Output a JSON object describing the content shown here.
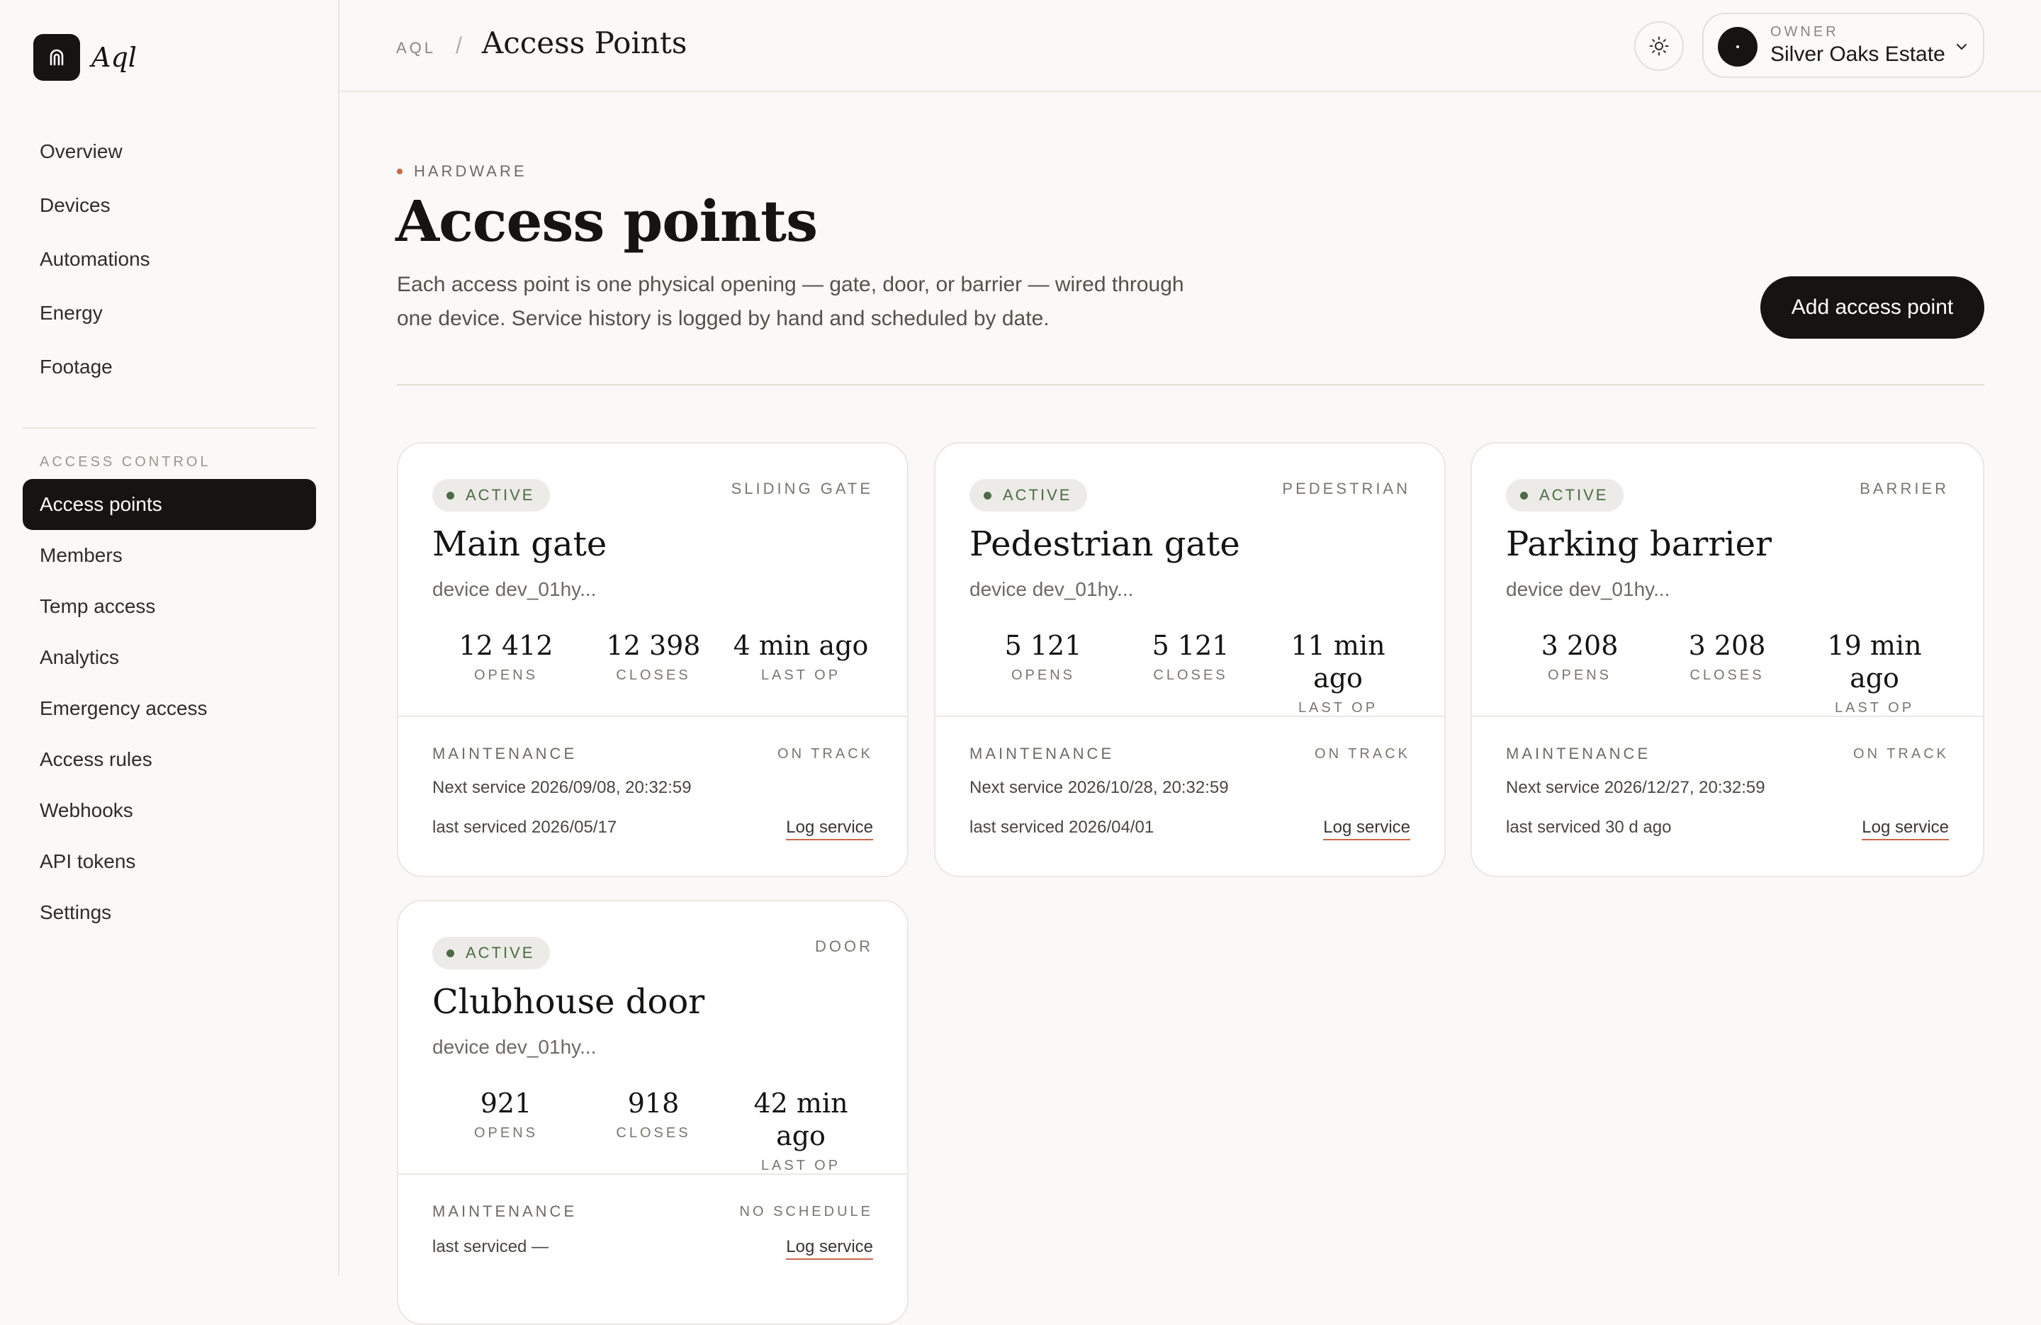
{
  "app": {
    "name": "Aql"
  },
  "sidebar": {
    "top_items": [
      {
        "label": "Overview"
      },
      {
        "label": "Devices"
      },
      {
        "label": "Automations"
      },
      {
        "label": "Energy"
      },
      {
        "label": "Footage"
      }
    ],
    "section_label": "ACCESS CONTROL",
    "access_items": [
      {
        "label": "Access points",
        "active": true
      },
      {
        "label": "Members"
      },
      {
        "label": "Temp access"
      },
      {
        "label": "Analytics"
      },
      {
        "label": "Emergency access"
      },
      {
        "label": "Access rules"
      },
      {
        "label": "Webhooks"
      },
      {
        "label": "API tokens"
      },
      {
        "label": "Settings"
      }
    ]
  },
  "topbar": {
    "breadcrumb_root": "AQL",
    "breadcrumb_sep": "/",
    "breadcrumb_current": "Access Points",
    "theme_icon": "sun-icon",
    "owner_label": "OWNER",
    "owner_name": "Silver Oaks Estate"
  },
  "header": {
    "eyebrow": "HARDWARE",
    "title": "Access points",
    "description": "Each access point is one physical opening — gate, door, or barrier — wired through one device. Service history is logged by hand and scheduled by date.",
    "add_button": "Add access point"
  },
  "colors": {
    "accent": "#c9684a",
    "primary": "#151413",
    "active_green": "#4d6b45"
  },
  "cards": [
    {
      "status": "ACTIVE",
      "type": "SLIDING GATE",
      "name": "Main gate",
      "device": "device dev_01hy...",
      "opens": "12 412",
      "opens_label": "OPENS",
      "closes": "12 398",
      "closes_label": "CLOSES",
      "last_op": "4 min ago",
      "last_op_label": "LAST OP",
      "maintenance_label": "MAINTENANCE",
      "maintenance_status": "ON TRACK",
      "next_service": "Next service 2026/09/08, 20:32:59",
      "last_serviced": "last serviced 2026/05/17",
      "log_label": "Log service"
    },
    {
      "status": "ACTIVE",
      "type": "PEDESTRIAN",
      "name": "Pedestrian gate",
      "device": "device dev_01hy...",
      "opens": "5 121",
      "opens_label": "OPENS",
      "closes": "5 121",
      "closes_label": "CLOSES",
      "last_op": "11 min ago",
      "last_op_label": "LAST OP",
      "maintenance_label": "MAINTENANCE",
      "maintenance_status": "ON TRACK",
      "next_service": "Next service 2026/10/28, 20:32:59",
      "last_serviced": "last serviced 2026/04/01",
      "log_label": "Log service"
    },
    {
      "status": "ACTIVE",
      "type": "BARRIER",
      "name": "Parking barrier",
      "device": "device dev_01hy...",
      "opens": "3 208",
      "opens_label": "OPENS",
      "closes": "3 208",
      "closes_label": "CLOSES",
      "last_op": "19 min ago",
      "last_op_label": "LAST OP",
      "maintenance_label": "MAINTENANCE",
      "maintenance_status": "ON TRACK",
      "next_service": "Next service 2026/12/27, 20:32:59",
      "last_serviced": "last serviced 30 d ago",
      "log_label": "Log service"
    },
    {
      "status": "ACTIVE",
      "type": "DOOR",
      "name": "Clubhouse door",
      "device": "device dev_01hy...",
      "opens": "921",
      "opens_label": "OPENS",
      "closes": "918",
      "closes_label": "CLOSES",
      "last_op": "42 min ago",
      "last_op_label": "LAST OP",
      "maintenance_label": "MAINTENANCE",
      "maintenance_status": "NO SCHEDULE",
      "last_serviced": "last serviced —",
      "log_label": "Log service"
    }
  ]
}
